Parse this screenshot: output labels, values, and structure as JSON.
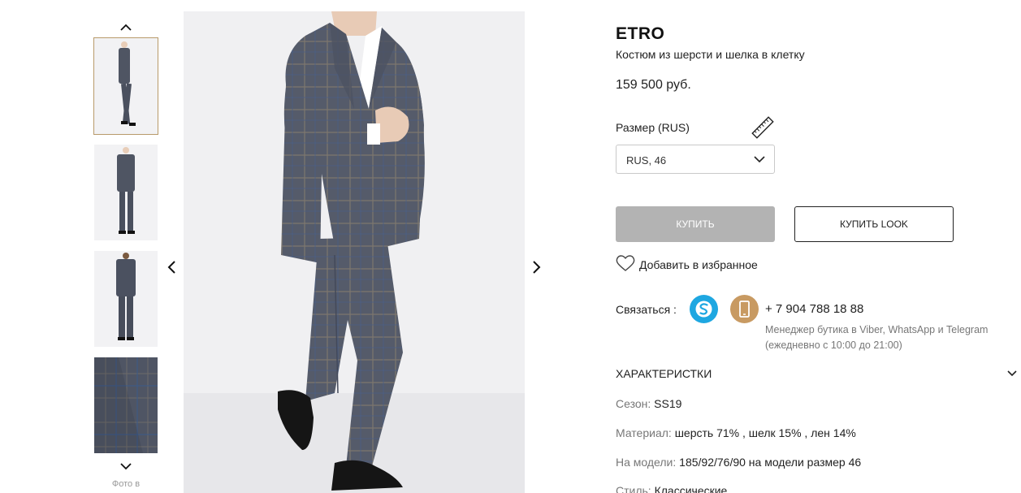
{
  "gallery": {
    "thumb_up": "chevron-up",
    "thumb_down": "chevron-down",
    "caption": "Фото в",
    "prev": "chevron-left",
    "next": "chevron-right"
  },
  "product": {
    "brand": "ETRO",
    "subtitle": "Костюм из шерсти и шелка в клетку",
    "price": "159 500 руб."
  },
  "size": {
    "label": "Размер (RUS)",
    "selected": "RUS, 46"
  },
  "buttons": {
    "buy": "КУПИТЬ",
    "buy_look": "КУПИТЬ LOOK",
    "favorite": "Добавить в избранное"
  },
  "contact": {
    "label": "Связаться :",
    "phone": "+ 7 904 788 18 88",
    "note_line1": "Менеджер бутика в Viber, WhatsApp и Telegram",
    "note_line2": "(ежедневно с 10:00 до 21:00)"
  },
  "characteristics": {
    "title": "ХАРАКТЕРИСТКИ",
    "items": [
      {
        "key": "Сезон:",
        "value": "SS19"
      },
      {
        "key": "Материал:",
        "value": "шерсть 71% , шелк 15% , лен 14%"
      },
      {
        "key": "На модели:",
        "value": "185/92/76/90 на модели размер 46"
      },
      {
        "key": "Стиль:",
        "value": "Классические"
      }
    ]
  },
  "colors": {
    "accent_border": "#b89a6a",
    "buy_disabled": "#b3b3b3",
    "skype": "#1ea7e1",
    "phone": "#c89a62"
  }
}
